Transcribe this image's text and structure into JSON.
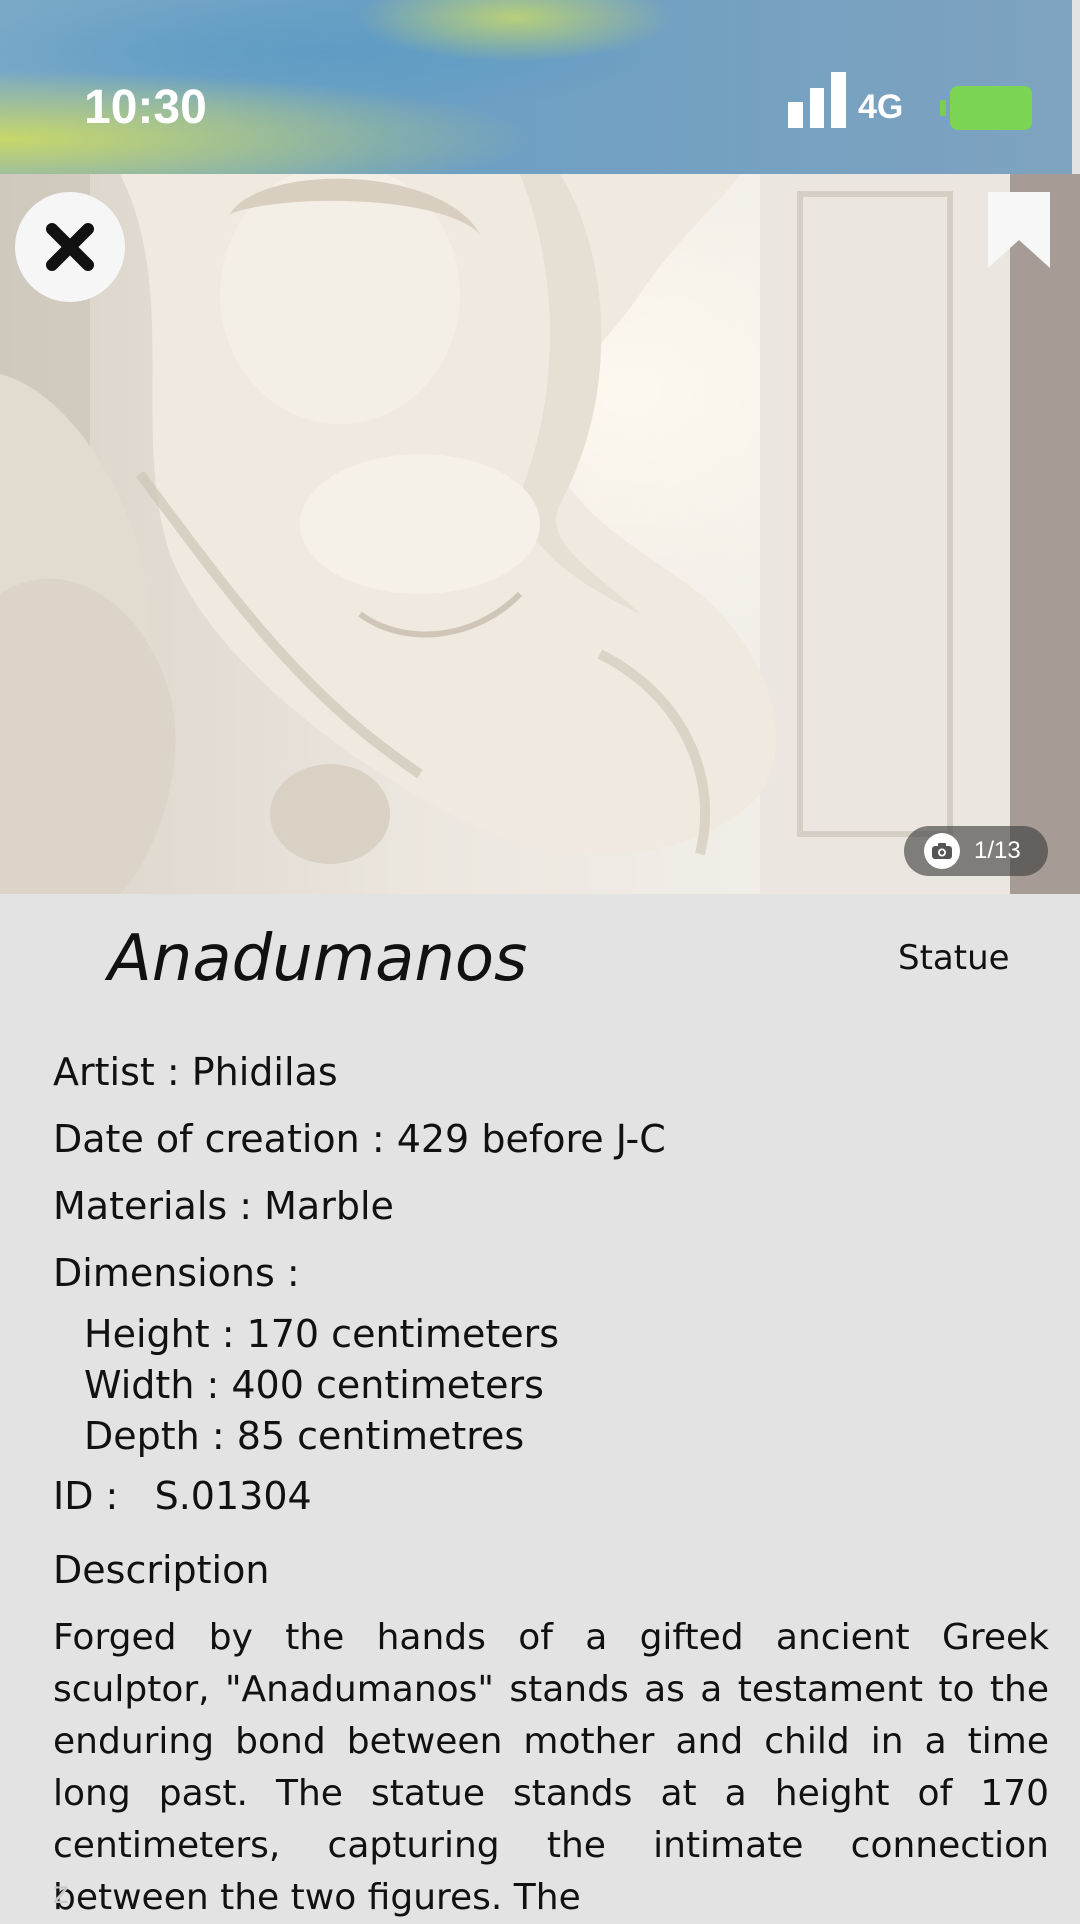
{
  "status": {
    "time": "10:30",
    "network": "4G",
    "battery_color": "#7bd453"
  },
  "artwork": {
    "title": "Anadumanos",
    "category": "Statue",
    "photo_counter": "1/13",
    "artist": "Artist : Phidilas",
    "date": "Date of creation : 429 before J-C",
    "materials": "Materials : Marble",
    "dimensions_label": "Dimensions :",
    "height": "Height : 170 centimeters",
    "width": "Width : 400 centimeters",
    "depth": "Depth : 85 centimetres",
    "id": "ID :   S.01304",
    "description_label": "Description",
    "description": "Forged by the hands of a gifted ancient Greek sculptor, \"Anadumanos\" stands as a testament to the enduring bond between mother and child in a time long past. The statue stands at a height of 170 centimeters, capturing the intimate connection between the two figures. The",
    "description_more": "z"
  },
  "icons": {
    "close": "close-icon",
    "bookmark": "bookmark-icon",
    "camera": "camera-icon"
  }
}
